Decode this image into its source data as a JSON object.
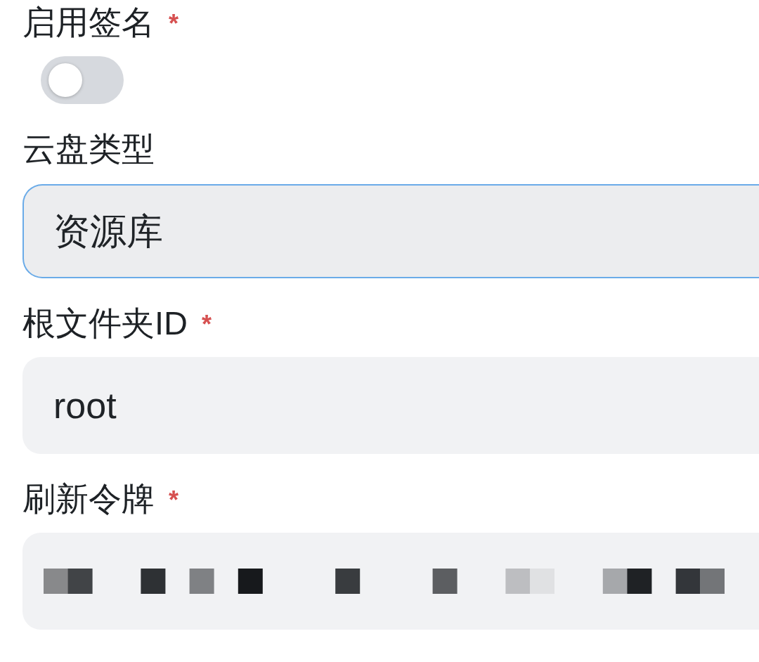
{
  "required_mark": "*",
  "fields": [
    {
      "kind": "switch",
      "label": "启用签名",
      "required": true,
      "on": false
    },
    {
      "kind": "select",
      "label": "云盘类型",
      "required": false,
      "value": "资源库",
      "focused": true
    },
    {
      "kind": "input",
      "label": "根文件夹ID",
      "required": true,
      "value": "root",
      "redacted": false
    },
    {
      "kind": "input",
      "label": "刷新令牌",
      "required": true,
      "redacted": true
    }
  ]
}
